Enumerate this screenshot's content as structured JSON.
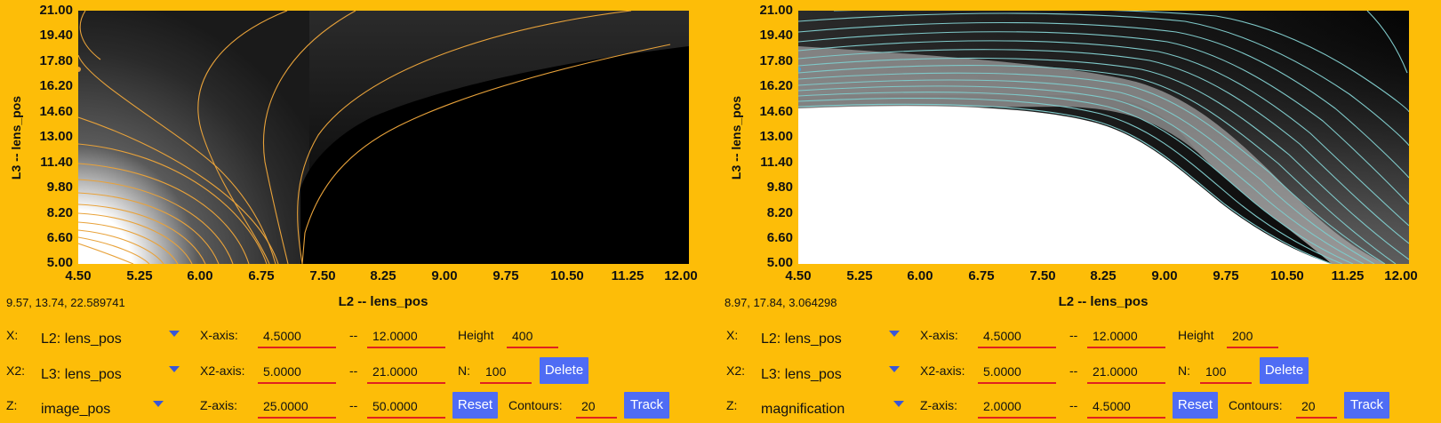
{
  "colors": {
    "background": "#FDBD08",
    "button": "#4f6cf4",
    "field_underline": "#e0221f"
  },
  "panels": [
    {
      "readout": "9.57, 13.74, 22.589741",
      "chart_data": {
        "type": "heatmap",
        "xlabel": "L2 -- lens_pos",
        "ylabel": "L3 -- lens_pos",
        "x_ticks": [
          "4.50",
          "5.25",
          "6.00",
          "6.75",
          "7.50",
          "8.25",
          "9.00",
          "9.75",
          "10.50",
          "11.25",
          "12.00"
        ],
        "y_ticks": [
          "21.00",
          "19.40",
          "17.80",
          "16.20",
          "14.60",
          "13.00",
          "11.40",
          "9.80",
          "8.20",
          "6.60",
          "5.00"
        ],
        "xlim": [
          4.5,
          12.0
        ],
        "ylim": [
          5.0,
          21.0
        ],
        "z_range": [
          25.0,
          50.0
        ],
        "contours": 20,
        "contour_color": "#e8a23a",
        "colormap": "white to black",
        "marker": {
          "x": 4.5,
          "y": 17.8,
          "color": "#e8a23a"
        }
      },
      "controls": {
        "x_label": "X:",
        "x_select": "L2: lens_pos",
        "x2_label": "X2:",
        "x2_select": "L3: lens_pos",
        "z_label": "Z:",
        "z_select": "image_pos",
        "xaxis_label": "X-axis:",
        "xaxis_min": "4.5000",
        "xaxis_max": "12.0000",
        "x2axis_label": "X2-axis:",
        "x2axis_min": "5.0000",
        "x2axis_max": "21.0000",
        "zaxis_label": "Z-axis:",
        "zaxis_min": "25.0000",
        "zaxis_max": "50.0000",
        "sep": "--",
        "height_label": "Height",
        "height_value": "400",
        "n_label": "N:",
        "n_value": "100",
        "contours_label": "Contours:",
        "contours_value": "20",
        "delete_label": "Delete",
        "reset_label": "Reset",
        "track_label": "Track"
      }
    },
    {
      "readout": "8.97, 17.84, 3.064298",
      "chart_data": {
        "type": "heatmap",
        "xlabel": "L2 -- lens_pos",
        "ylabel": "L3 -- lens_pos",
        "x_ticks": [
          "4.50",
          "5.25",
          "6.00",
          "6.75",
          "7.50",
          "8.25",
          "9.00",
          "9.75",
          "10.50",
          "11.25",
          "12.00"
        ],
        "y_ticks": [
          "21.00",
          "19.40",
          "17.80",
          "16.20",
          "14.60",
          "13.00",
          "11.40",
          "9.80",
          "8.20",
          "6.60",
          "5.00"
        ],
        "xlim": [
          4.5,
          12.0
        ],
        "ylim": [
          5.0,
          21.0
        ],
        "z_range": [
          2.0,
          4.5
        ],
        "contours": 20,
        "contour_color": "#7fc9c9",
        "colormap": "white to black",
        "marker": {
          "x": 4.5,
          "y": 17.8,
          "color": "#4aa3d8"
        }
      },
      "controls": {
        "x_label": "X:",
        "x_select": "L2: lens_pos",
        "x2_label": "X2:",
        "x2_select": "L3: lens_pos",
        "z_label": "Z:",
        "z_select": "magnification",
        "xaxis_label": "X-axis:",
        "xaxis_min": "4.5000",
        "xaxis_max": "12.0000",
        "x2axis_label": "X2-axis:",
        "x2axis_min": "5.0000",
        "x2axis_max": "21.0000",
        "zaxis_label": "Z-axis:",
        "zaxis_min": "2.0000",
        "zaxis_max": "4.5000",
        "sep": "--",
        "height_label": "Height",
        "height_value": "200",
        "n_label": "N:",
        "n_value": "100",
        "contours_label": "Contours:",
        "contours_value": "20",
        "delete_label": "Delete",
        "reset_label": "Reset",
        "track_label": "Track"
      }
    }
  ]
}
